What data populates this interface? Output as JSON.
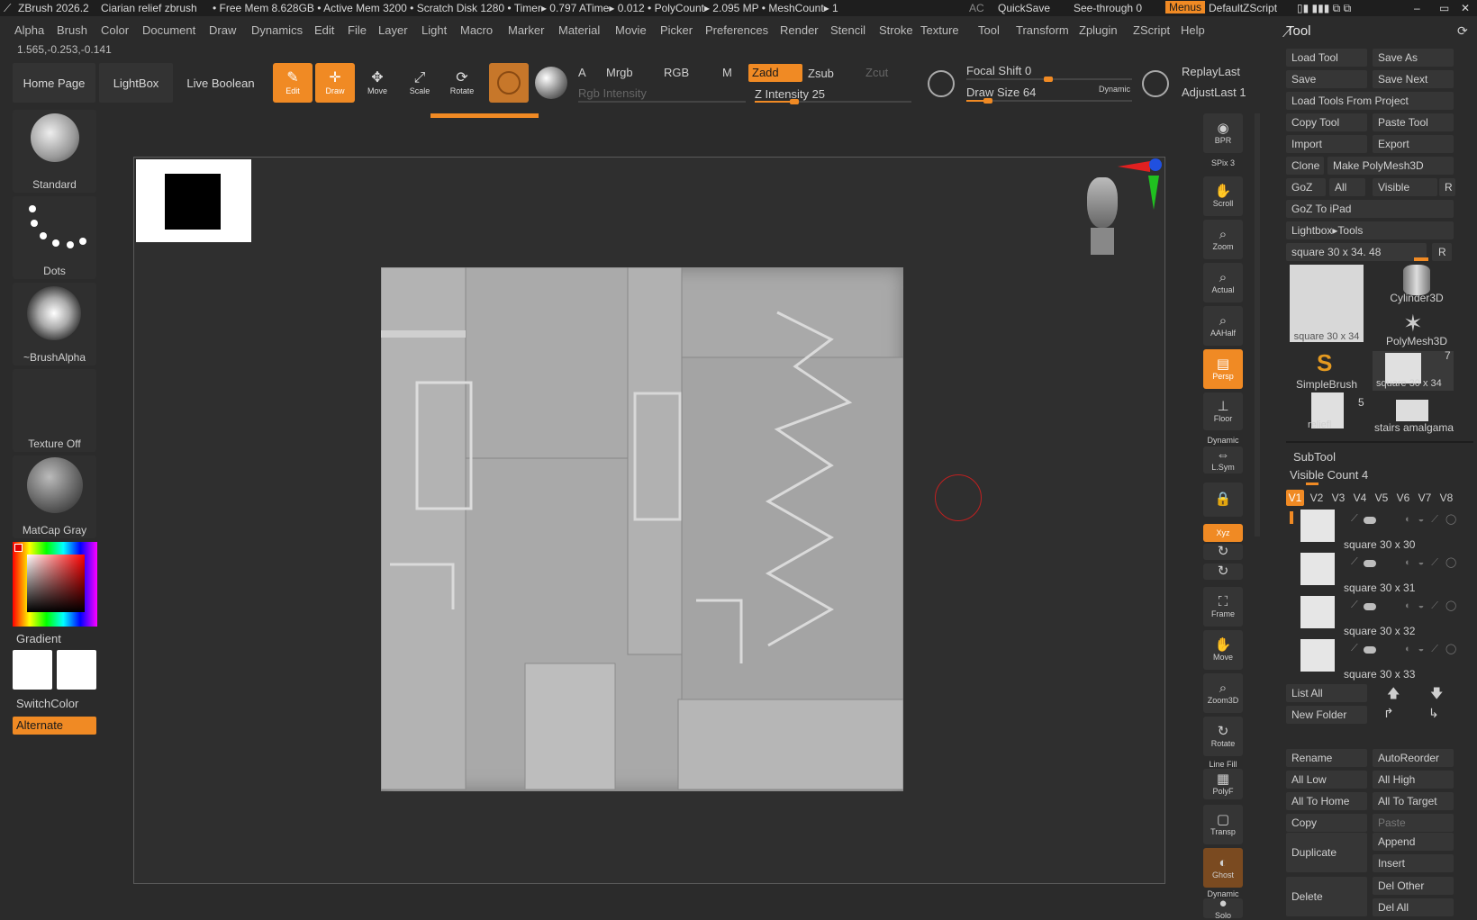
{
  "titlebar": {
    "app": "ZBrush 2026.2",
    "doc": "Ciarian relief zbrush",
    "stats": "• Free Mem 8.628GB • Active Mem 3200 • Scratch Disk 1280 • Timer▸ 0.797 ATime▸ 0.012 • PolyCount▸ 2.095 MP • MeshCount▸ 1",
    "ac": "AC",
    "quicksave": "QuickSave",
    "seethrough": "See-through  0",
    "menus": "Menus",
    "script": "DefaultZScript"
  },
  "menubar": [
    "Alpha",
    "Brush",
    "Color",
    "Document",
    "Draw",
    "Dynamics",
    "Edit",
    "File",
    "Layer",
    "Light",
    "Macro",
    "Marker",
    "Material",
    "Movie",
    "Picker",
    "Preferences",
    "Render",
    "Stencil",
    "Stroke",
    "Texture",
    "Tool",
    "Transform",
    "Zplugin",
    "ZScript",
    "Help"
  ],
  "coords": "1.565,-0.253,-0.141",
  "shelf": {
    "home": "Home Page",
    "lightbox": "LightBox",
    "liveboolean": "Live Boolean",
    "edit": "Edit",
    "draw": "Draw",
    "move": "Move",
    "scale": "Scale",
    "rotate": "Rotate",
    "a": "A",
    "mrgb": "Mrgb",
    "rgb": "RGB",
    "m": "M",
    "zadd": "Zadd",
    "zsub": "Zsub",
    "zcut": "Zcut",
    "rgb_intensity": "Rgb Intensity",
    "z_intensity": "Z Intensity 25",
    "focal_shift": "Focal Shift 0",
    "draw_size": "Draw Size 64",
    "dynamic": "Dynamic",
    "replaylast": "ReplayLast",
    "adjustlast": "AdjustLast  1",
    "z_intensity_frac": 0.25,
    "draw_size_frac": 0.13
  },
  "left": {
    "standard": "Standard",
    "dots": "Dots",
    "brushalpha": "~BrushAlpha",
    "textureoff": "Texture Off",
    "matcap": "MatCap Gray",
    "gradient": "Gradient",
    "switchcolor": "SwitchColor",
    "alternate": "Alternate"
  },
  "right_shelf": [
    "BPR",
    "SPix 3",
    "Scroll",
    "Zoom",
    "Actual",
    "AAHalf",
    "Persp",
    "Floor",
    "Dynamic",
    "L.Sym",
    "",
    "Xyz",
    "",
    "",
    "Frame",
    "Move",
    "Zoom3D",
    "Rotate",
    "Line Fill",
    "PolyF",
    "Transp",
    "Ghost",
    "Dynamic",
    "Solo"
  ],
  "tool": {
    "title": "Tool",
    "rows": [
      [
        "Load Tool",
        "Save As"
      ],
      [
        "Save",
        "Save Next"
      ],
      [
        "Load Tools From Project",
        ""
      ],
      [
        "Copy Tool",
        "Paste Tool"
      ],
      [
        "Import",
        "Export"
      ],
      [
        "Clone",
        "Make PolyMesh3D"
      ],
      [
        "GoZ",
        "All",
        "Visible",
        "R"
      ],
      [
        "GoZ To iPad",
        ""
      ],
      [
        "Lightbox▸Tools",
        ""
      ]
    ],
    "current": "square 30 x 34. 48",
    "r": "R",
    "thumbs": [
      "square 30 x 34",
      "Cylinder3D",
      "PolyMesh3D",
      "SimpleBrush",
      "square 30 x 34",
      "reliefl",
      "stairs amalgama"
    ],
    "thumb_count_7": "7",
    "thumb_count_5": "5"
  },
  "subtool": {
    "title": "SubTool",
    "visible_count": "Visible Count 4",
    "tabs": [
      "V1",
      "V2",
      "V3",
      "V4",
      "V5",
      "V6",
      "V7",
      "V8"
    ],
    "items": [
      "square 30 x 30",
      "square 30 x 31",
      "square 30 x 32",
      "square 30 x 33"
    ],
    "list_all": "List All",
    "new_folder": "New Folder",
    "buttons": [
      [
        "Rename",
        "AutoReorder"
      ],
      [
        "All Low",
        "All High"
      ],
      [
        "All To Home",
        "All To Target"
      ],
      [
        "Copy",
        "Paste"
      ]
    ],
    "duplicate": "Duplicate",
    "append": "Append",
    "insert": "Insert",
    "delete": "Delete",
    "del_other": "Del Other",
    "del_all": "Del All"
  },
  "colors": {
    "accent": "#f08a24",
    "bg": "#2b2b2b",
    "panel": "#363636"
  }
}
